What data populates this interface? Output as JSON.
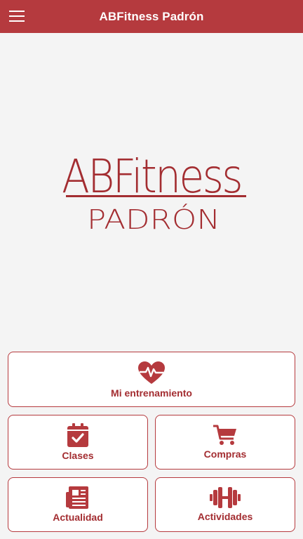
{
  "appbar": {
    "title": "ABFitness Padrón",
    "menu_icon": "hamburger-menu-icon"
  },
  "logo": {
    "line1": "ABFitness",
    "line2": "PADRÓN"
  },
  "colors": {
    "brand": "#b53a3e",
    "label": "#a32d31",
    "background": "#f4f4f4",
    "tile_bg": "#ffffff"
  },
  "menu": {
    "training": {
      "label": "Mi entrenamiento",
      "icon": "heart-pulse-icon"
    },
    "classes": {
      "label": "Clases",
      "icon": "calendar-check-icon"
    },
    "shop": {
      "label": "Compras",
      "icon": "shopping-cart-icon"
    },
    "news": {
      "label": "Actualidad",
      "icon": "newspaper-icon"
    },
    "activities": {
      "label": "Actividades",
      "icon": "dumbbell-icon"
    }
  }
}
